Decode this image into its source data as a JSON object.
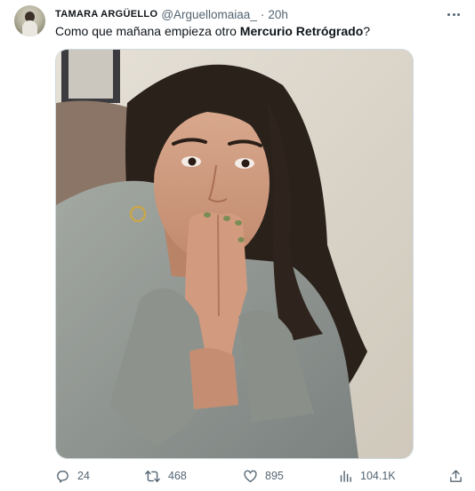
{
  "tweet": {
    "author_name": "TAMARA ARGÜELLO",
    "handle": "@Arguellomaiaa_",
    "separator": "·",
    "time": "20h",
    "text_before": "Como que mañana empieza otro ",
    "text_bold": "Mercurio Retrógrado",
    "text_after": "?",
    "image_icon": "photo-of-woman-covering-mouth-with-hands"
  },
  "actions": {
    "replies": "24",
    "retweets": "468",
    "likes": "895",
    "views": "104.1K"
  },
  "icons": {
    "more": "more-dots-icon",
    "reply": "reply-icon",
    "retweet": "retweet-icon",
    "like": "heart-icon",
    "views": "views-chart-icon",
    "share": "share-icon"
  },
  "colors": {
    "text": "#0f1419",
    "secondary": "#536471",
    "border": "#cfd9de"
  }
}
